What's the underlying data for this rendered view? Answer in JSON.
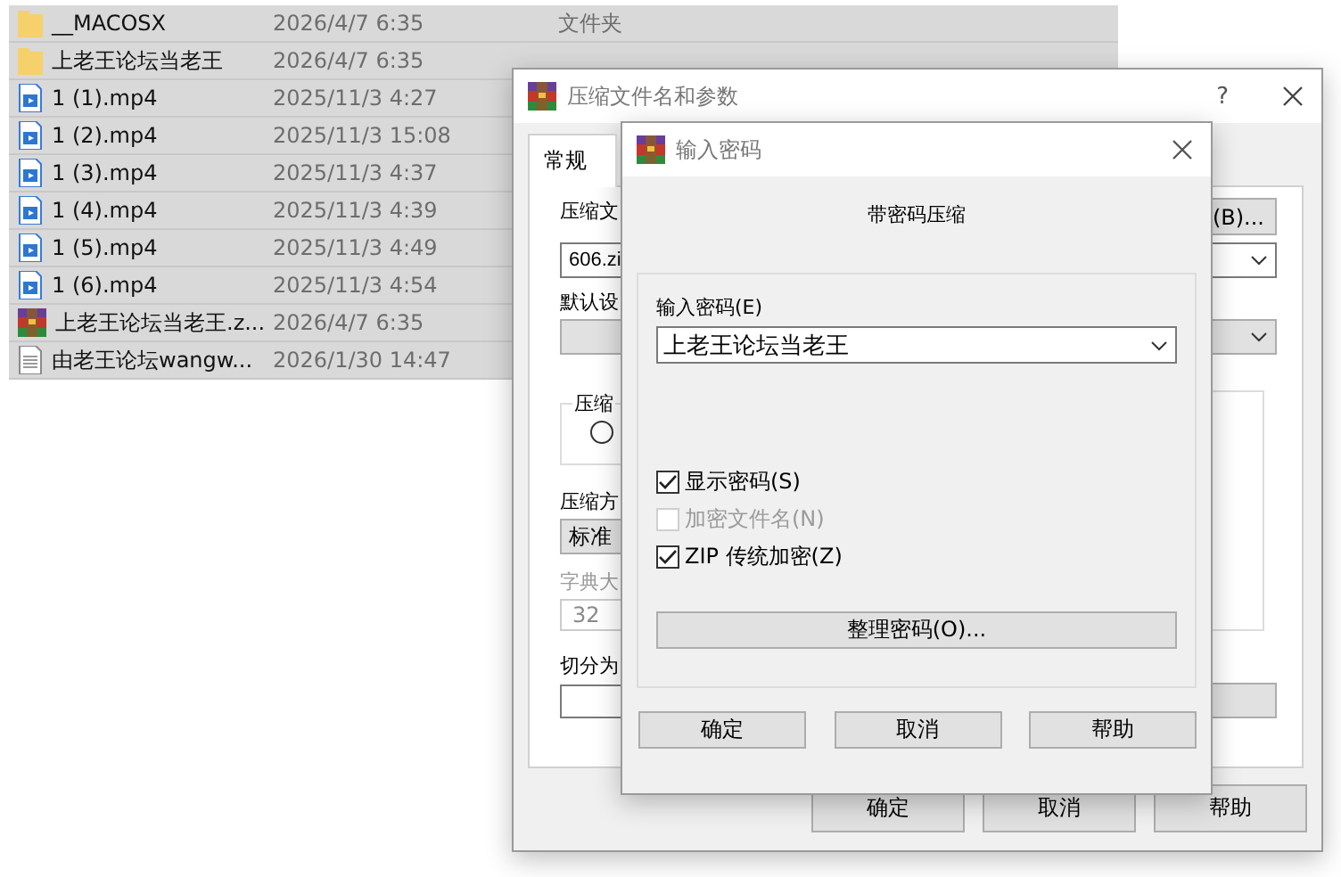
{
  "file_list": {
    "rows": [
      {
        "kind": "folder",
        "name": "__MACOSX",
        "date": "2026/4/7 6:35",
        "type": "文件夹",
        "selected": true
      },
      {
        "kind": "folder",
        "name": "上老王论坛当老王",
        "date": "2026/4/7 6:35",
        "selected": true
      },
      {
        "kind": "video",
        "name": "1 (1).mp4",
        "date": "2025/11/3 4:27",
        "selected": true
      },
      {
        "kind": "video",
        "name": "1 (2).mp4",
        "date": "2025/11/3 15:08",
        "selected": true
      },
      {
        "kind": "video",
        "name": "1 (3).mp4",
        "date": "2025/11/3 4:37",
        "selected": true
      },
      {
        "kind": "video",
        "name": "1 (4).mp4",
        "date": "2025/11/3 4:39",
        "selected": true
      },
      {
        "kind": "video",
        "name": "1 (5).mp4",
        "date": "2025/11/3 4:49",
        "selected": true
      },
      {
        "kind": "video",
        "name": "1 (6).mp4",
        "date": "2025/11/3 4:54",
        "selected": true
      },
      {
        "kind": "archive",
        "name": "上老王论坛当老王.z...",
        "date": "2026/4/7 6:35",
        "selected": true
      },
      {
        "kind": "text",
        "name": "由老王论坛wangw...",
        "date": "2026/1/30 14:47",
        "selected": true
      }
    ]
  },
  "archive_dialog": {
    "title": "压缩文件名和参数",
    "help": "?",
    "tabs": [
      {
        "label": "常规",
        "selected": true
      }
    ],
    "archive_name_label": "压缩文",
    "browse_button": "(B)...",
    "archive_name": "606.zi",
    "profile_label": "默认设",
    "format_group_label": "压缩",
    "format_radio": {
      "selected": false
    },
    "method_label": "压缩方",
    "method": "标准",
    "dictionary_label": "字典大",
    "dictionary": "32",
    "dictionary_disabled": true,
    "split_label": "切分为",
    "buttons": [
      "确定",
      "取消",
      "帮助"
    ]
  },
  "password_dialog": {
    "title": "输入密码",
    "heading": "带密码压缩",
    "password_label": "输入密码(E)",
    "password": "上老王论坛当老王",
    "options": [
      {
        "label": "显示密码(S)",
        "checked": true,
        "disabled": false
      },
      {
        "label": "加密文件名(N)",
        "checked": false,
        "disabled": true
      },
      {
        "label": "ZIP 传统加密(Z)",
        "checked": true,
        "disabled": false
      }
    ],
    "organize_button": "整理密码(O)...",
    "buttons": [
      "确定",
      "取消",
      "帮助"
    ]
  }
}
